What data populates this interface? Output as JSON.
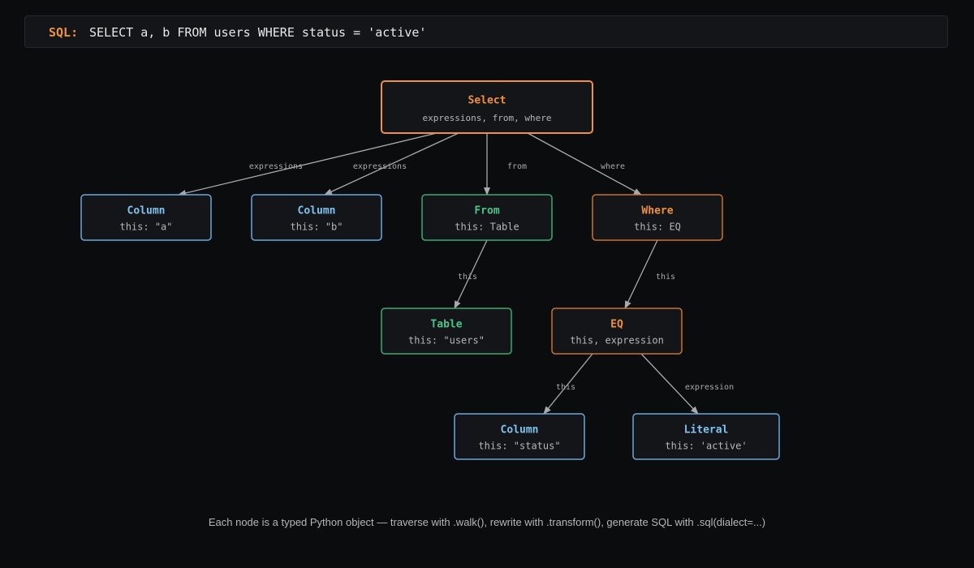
{
  "sql": {
    "label": "SQL:",
    "query": "SELECT a, b FROM users WHERE status = 'active'"
  },
  "colors": {
    "background": "#0b0c0e",
    "node_fill": "#141518",
    "orange": "#f0913f",
    "orange_border": "#c8732e",
    "blue": "#7ec3f0",
    "blue_border": "#6aa6d8",
    "green": "#4cc38a",
    "green_border": "#3fa872",
    "edge": "#a8aaae",
    "subtext": "#b4b6ba"
  },
  "nodes": [
    {
      "id": "select",
      "title": "Select",
      "subtitle": "expressions, from, where",
      "kind": "orange-root"
    },
    {
      "id": "col-a",
      "title": "Column",
      "subtitle": "this: \"a\"",
      "kind": "blue"
    },
    {
      "id": "col-b",
      "title": "Column",
      "subtitle": "this: \"b\"",
      "kind": "blue"
    },
    {
      "id": "from",
      "title": "From",
      "subtitle": "this: Table",
      "kind": "green"
    },
    {
      "id": "where",
      "title": "Where",
      "subtitle": "this: EQ",
      "kind": "orange"
    },
    {
      "id": "table",
      "title": "Table",
      "subtitle": "this: \"users\"",
      "kind": "green"
    },
    {
      "id": "eq",
      "title": "EQ",
      "subtitle": "this, expression",
      "kind": "orange"
    },
    {
      "id": "col-status",
      "title": "Column",
      "subtitle": "this: \"status\"",
      "kind": "blue"
    },
    {
      "id": "literal",
      "title": "Literal",
      "subtitle": "this: 'active'",
      "kind": "blue"
    }
  ],
  "edges": [
    {
      "from": "select",
      "to": "col-a",
      "label": "expressions"
    },
    {
      "from": "select",
      "to": "col-b",
      "label": "expressions"
    },
    {
      "from": "select",
      "to": "from",
      "label": "from"
    },
    {
      "from": "select",
      "to": "where",
      "label": "where"
    },
    {
      "from": "from",
      "to": "table",
      "label": "this"
    },
    {
      "from": "where",
      "to": "eq",
      "label": "this"
    },
    {
      "from": "eq",
      "to": "col-status",
      "label": "this"
    },
    {
      "from": "eq",
      "to": "literal",
      "label": "expression"
    }
  ],
  "footer": "Each node is a typed Python object — traverse with .walk(), rewrite with .transform(), generate SQL with .sql(dialect=...)"
}
